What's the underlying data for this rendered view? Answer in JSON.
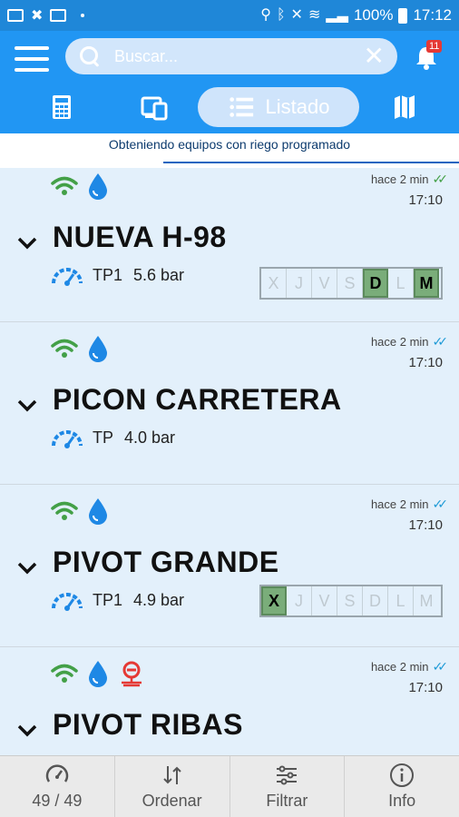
{
  "status_bar": {
    "battery": "100%",
    "time": "17:12"
  },
  "header": {
    "search_placeholder": "Buscar...",
    "notification_count": "11",
    "active_tab_label": "Listado"
  },
  "loading_text": "Obteniendo equipos con riego programado",
  "cards": [
    {
      "name": "NUEVA H-98",
      "ago": "hace 2 min",
      "time": "17:10",
      "check_color": "green",
      "sensor_label": "TP1",
      "sensor_value": "5.6 bar",
      "days": [
        {
          "d": "X",
          "on": false
        },
        {
          "d": "J",
          "on": false
        },
        {
          "d": "V",
          "on": false
        },
        {
          "d": "S",
          "on": false
        },
        {
          "d": "D",
          "on": true
        },
        {
          "d": "L",
          "on": false
        },
        {
          "d": "M",
          "on": true
        }
      ]
    },
    {
      "name": "PICON CARRETERA",
      "ago": "hace 2 min",
      "time": "17:10",
      "check_color": "blue",
      "sensor_label": "TP",
      "sensor_value": "4.0 bar",
      "days": []
    },
    {
      "name": "PIVOT GRANDE",
      "ago": "hace 2 min",
      "time": "17:10",
      "check_color": "blue",
      "sensor_label": "TP1",
      "sensor_value": "4.9 bar",
      "days": [
        {
          "d": "X",
          "on": true
        },
        {
          "d": "J",
          "on": false
        },
        {
          "d": "V",
          "on": false
        },
        {
          "d": "S",
          "on": false
        },
        {
          "d": "D",
          "on": false
        },
        {
          "d": "L",
          "on": false
        },
        {
          "d": "M",
          "on": false
        }
      ]
    },
    {
      "name": "PIVOT RIBAS",
      "ago": "hace 2 min",
      "time": "17:10",
      "check_color": "blue",
      "sensor_label": "",
      "sensor_value": "",
      "days": []
    }
  ],
  "bottom_bar": {
    "count": "49 / 49",
    "sort": "Ordenar",
    "filter": "Filtrar",
    "info": "Info"
  },
  "colors": {
    "primary": "#2196f3",
    "status_bar": "#1f87d8",
    "card_bg": "#e3f0fb",
    "wifi_green": "#43a047",
    "drop_blue": "#1e88e5",
    "alert_red": "#e53935",
    "day_on": "#7aad7a"
  }
}
